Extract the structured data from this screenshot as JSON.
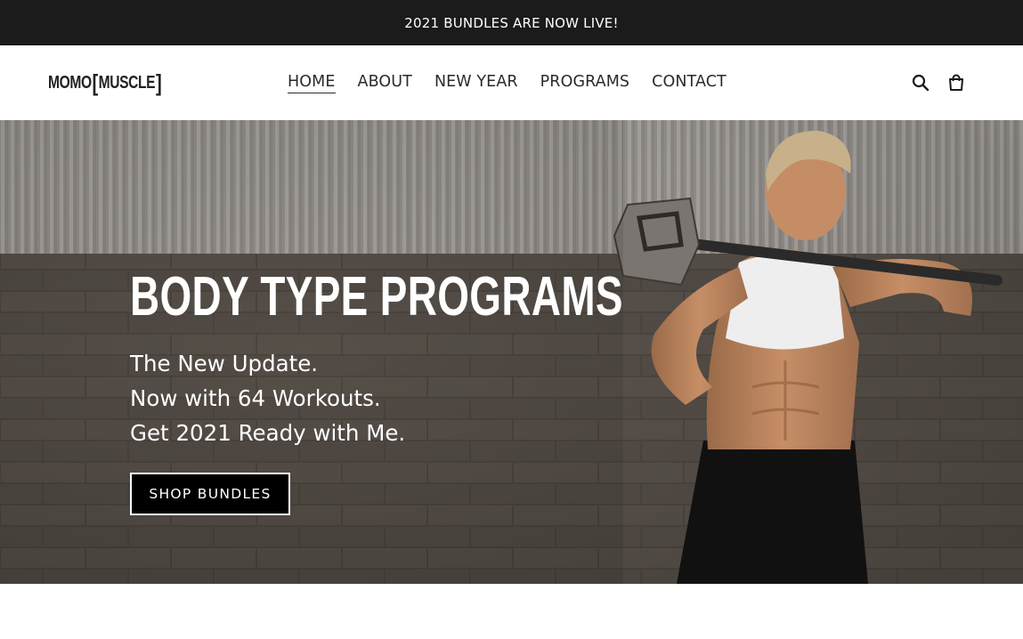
{
  "announcement": {
    "text": "2021 BUNDLES ARE NOW LIVE!"
  },
  "header": {
    "logo": {
      "word1": "MOMO",
      "word2": "MUSCLE",
      "bracket_open": "[",
      "bracket_close": "]"
    },
    "nav": [
      {
        "label": "HOME",
        "active": true
      },
      {
        "label": "ABOUT",
        "active": false
      },
      {
        "label": "NEW YEAR",
        "active": false
      },
      {
        "label": "PROGRAMS",
        "active": false
      },
      {
        "label": "CONTACT",
        "active": false
      }
    ],
    "icons": {
      "search": "search-icon",
      "cart": "cart-icon"
    }
  },
  "hero": {
    "title": "BODY TYPE PROGRAMS",
    "lines": [
      "The New Update.",
      "Now with 64 Workouts.",
      "Get 2021 Ready with Me."
    ],
    "button_label": "SHOP BUNDLES"
  },
  "colors": {
    "announcement_bg": "#1b1b1b",
    "text": "#2b2b2b",
    "button_bg": "#000000",
    "button_border": "#ffffff"
  }
}
